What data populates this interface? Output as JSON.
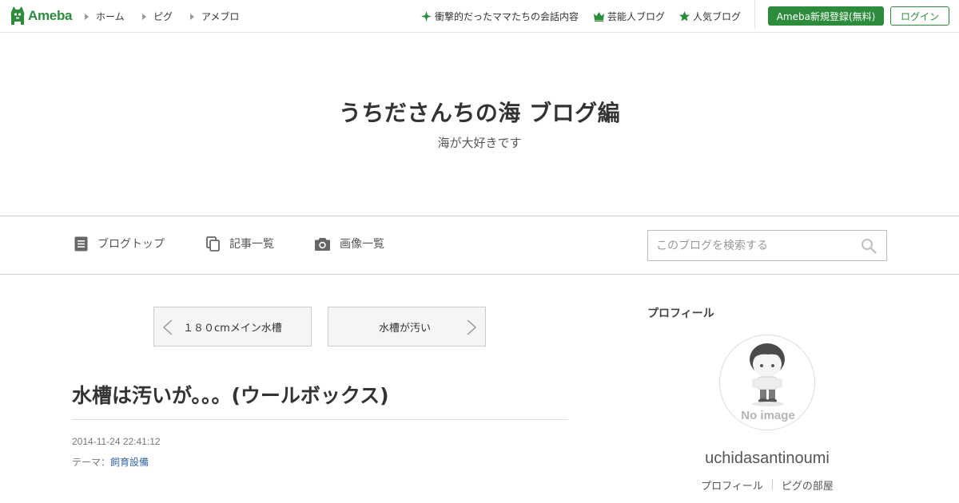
{
  "topbar": {
    "logo_text": "Ameba",
    "nav": [
      "ホーム",
      "ピグ",
      "アメブロ"
    ],
    "links": [
      {
        "label": "衝撃的だったママたちの会話内容",
        "icon": "sparkle-icon"
      },
      {
        "label": "芸能人ブログ",
        "icon": "crown-icon"
      },
      {
        "label": "人気ブログ",
        "icon": "star-icon"
      }
    ],
    "register_label": "Ameba新規登録(無料)",
    "login_label": "ログイン",
    "accent_color": "#2d8c3c"
  },
  "blog": {
    "title": "うちださんちの海 ブログ編",
    "description": "海が大好きです"
  },
  "blognav": {
    "items": [
      {
        "label": "ブログトップ",
        "icon": "document-icon"
      },
      {
        "label": "記事一覧",
        "icon": "copy-icon"
      },
      {
        "label": "画像一覧",
        "icon": "camera-icon"
      }
    ],
    "search_placeholder": "このブログを検索する"
  },
  "pager": {
    "prev_label": "１８０cmメイン水槽",
    "next_label": "水槽が汚い"
  },
  "entry": {
    "title": "水槽は汚いが。。。(ウールボックス)",
    "date": "2014-11-24 22:41:12",
    "theme_prefix": "テーマ：",
    "theme_link": "飼育設備"
  },
  "sidebar": {
    "heading": "プロフィール",
    "avatar_text": "No image",
    "username": "uchidasantinoumi",
    "links": [
      "プロフィール",
      "ピグの部屋"
    ]
  }
}
